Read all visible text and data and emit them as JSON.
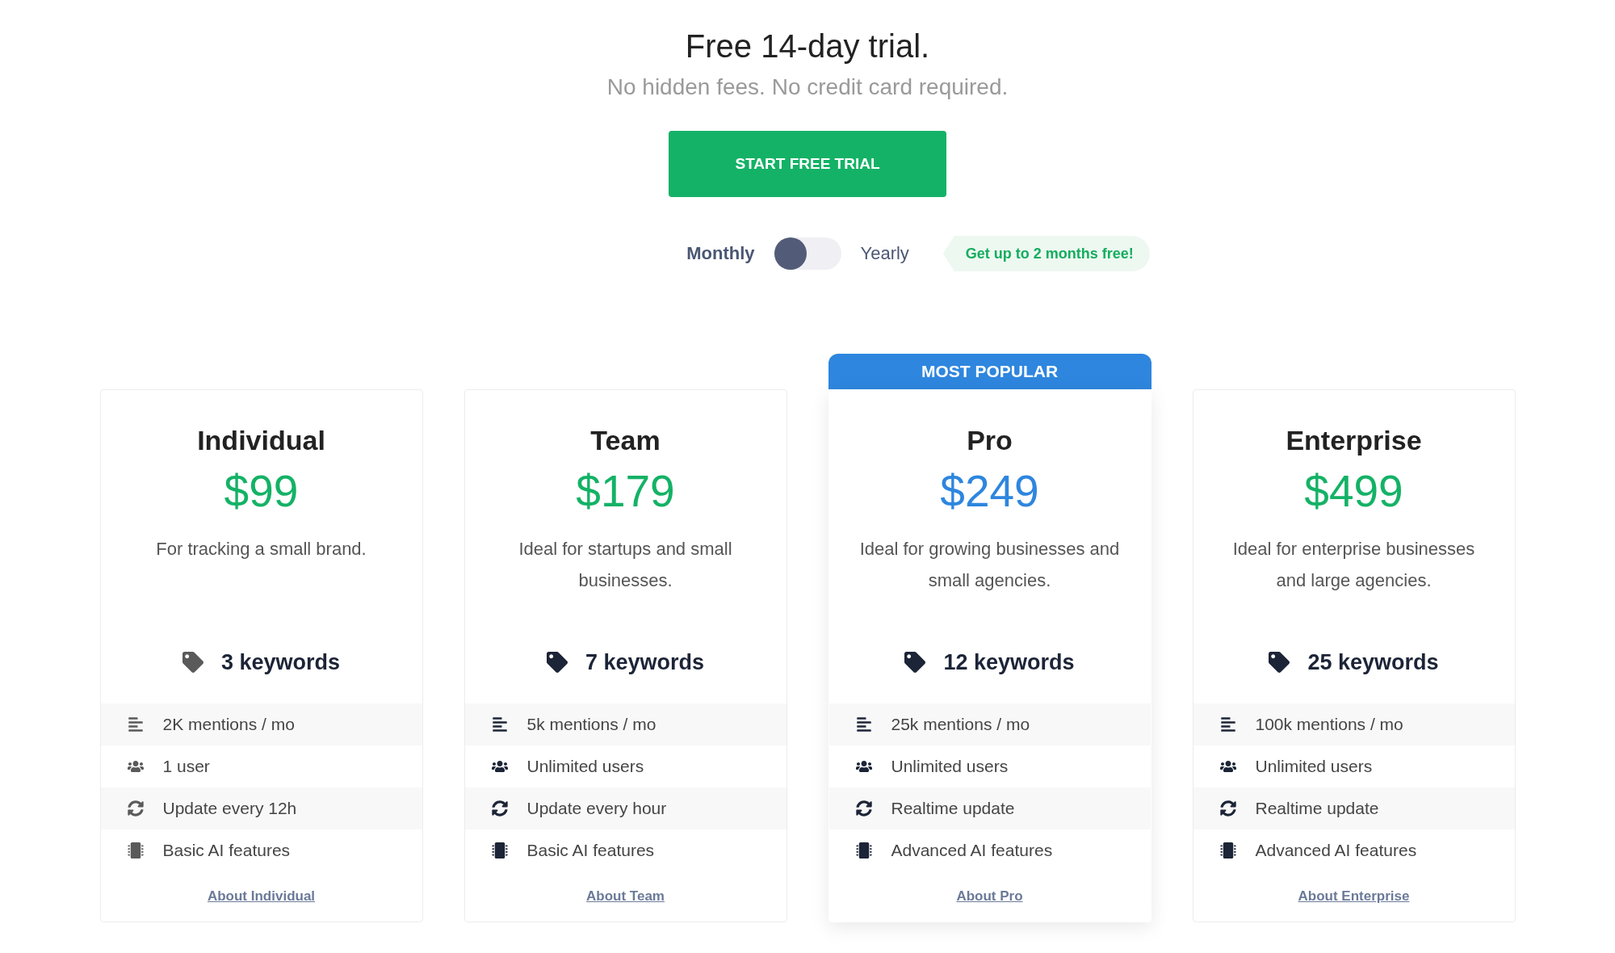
{
  "hero": {
    "title": "Free 14-day trial.",
    "subtitle": "No hidden fees. No credit card required.",
    "cta": "START FREE TRIAL"
  },
  "billing": {
    "options": [
      {
        "label": "Monthly",
        "selected": true
      },
      {
        "label": "Yearly",
        "selected": false
      }
    ],
    "promo": "Get up to 2 months free!"
  },
  "plans": [
    {
      "name": "Individual",
      "price": "$99",
      "description": "For tracking a small brand.",
      "keywords": "3 keywords",
      "featured": false,
      "muted": true,
      "features": [
        {
          "kind": "mentions",
          "text": "2K mentions / mo"
        },
        {
          "kind": "users",
          "text": "1 user"
        },
        {
          "kind": "update",
          "text": "Update every 12h"
        },
        {
          "kind": "ai",
          "text": "Basic AI features"
        }
      ],
      "link": "About Individual"
    },
    {
      "name": "Team",
      "price": "$179",
      "description": "Ideal for startups and small businesses.",
      "keywords": "7 keywords",
      "featured": false,
      "muted": false,
      "features": [
        {
          "kind": "mentions",
          "text": "5k mentions / mo"
        },
        {
          "kind": "users",
          "text": "Unlimited users"
        },
        {
          "kind": "update",
          "text": "Update every hour"
        },
        {
          "kind": "ai",
          "text": "Basic AI features"
        }
      ],
      "link": "About Team"
    },
    {
      "badge": "MOST POPULAR",
      "name": "Pro",
      "price": "$249",
      "description": "Ideal for growing businesses and small agencies.",
      "keywords": "12 keywords",
      "featured": true,
      "muted": false,
      "features": [
        {
          "kind": "mentions",
          "text": "25k mentions / mo"
        },
        {
          "kind": "users",
          "text": "Unlimited users"
        },
        {
          "kind": "update",
          "text": "Realtime update"
        },
        {
          "kind": "ai",
          "text": "Advanced AI features"
        }
      ],
      "link": "About Pro"
    },
    {
      "name": "Enterprise",
      "price": "$499",
      "description": "Ideal for enterprise businesses and large agencies.",
      "keywords": "25 keywords",
      "featured": false,
      "muted": false,
      "features": [
        {
          "kind": "mentions",
          "text": "100k mentions / mo"
        },
        {
          "kind": "users",
          "text": "Unlimited users"
        },
        {
          "kind": "update",
          "text": "Realtime update"
        },
        {
          "kind": "ai",
          "text": "Advanced AI features"
        }
      ],
      "link": "About Enterprise"
    }
  ]
}
